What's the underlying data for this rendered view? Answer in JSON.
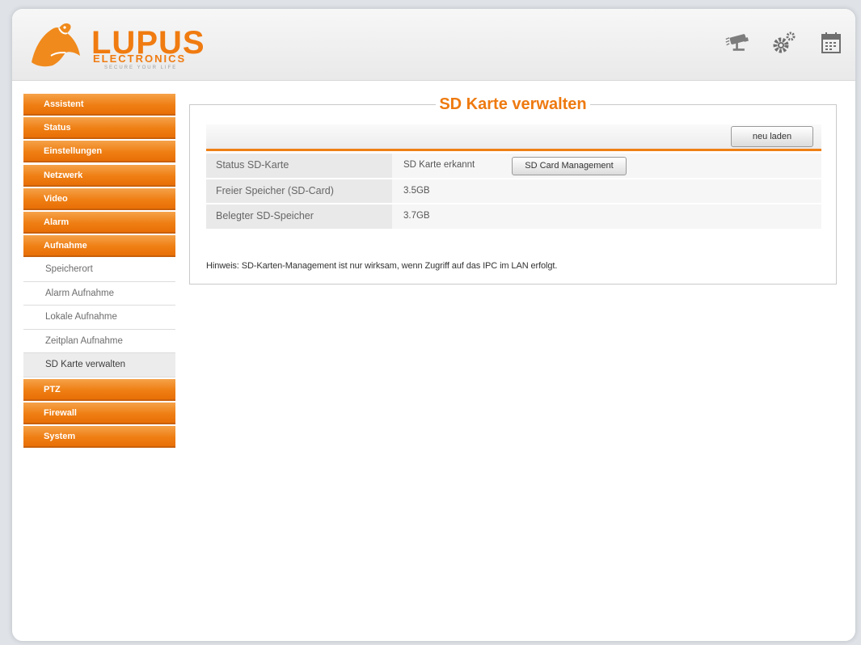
{
  "header": {
    "logo_brand": "LUPUS",
    "logo_sub": "ELECTRONICS",
    "logo_tagline": "SECURE YOUR LIFE",
    "icons": [
      "camera-icon",
      "gear-icon",
      "calendar-icon"
    ]
  },
  "colors": {
    "accent": "#ef7f14",
    "accent_dark": "#c9600b",
    "panel_border": "#c9c9c9"
  },
  "sidebar": {
    "items_top": [
      {
        "label": "Assistent"
      },
      {
        "label": "Status"
      },
      {
        "label": "Einstellungen"
      },
      {
        "label": "Netzwerk"
      },
      {
        "label": "Video"
      },
      {
        "label": "Alarm"
      },
      {
        "label": "Aufnahme"
      }
    ],
    "sub_items": [
      {
        "label": "Speicherort"
      },
      {
        "label": "Alarm Aufnahme"
      },
      {
        "label": "Lokale Aufnahme"
      },
      {
        "label": "Zeitplan Aufnahme"
      },
      {
        "label": "SD Karte verwalten",
        "active": true
      }
    ],
    "items_bottom": [
      {
        "label": "PTZ"
      },
      {
        "label": "Firewall"
      },
      {
        "label": "System"
      }
    ]
  },
  "main": {
    "title": "SD Karte verwalten",
    "reload_label": "neu laden",
    "rows": [
      {
        "label": "Status SD-Karte",
        "value": "SD Karte erkannt",
        "button": "SD Card Management"
      },
      {
        "label": "Freier Speicher (SD-Card)",
        "value": "3.5GB"
      },
      {
        "label": "Belegter SD-Speicher",
        "value": "3.7GB"
      }
    ],
    "hint": "Hinweis: SD-Karten-Management ist nur wirksam, wenn Zugriff auf das IPC im LAN erfolgt."
  }
}
